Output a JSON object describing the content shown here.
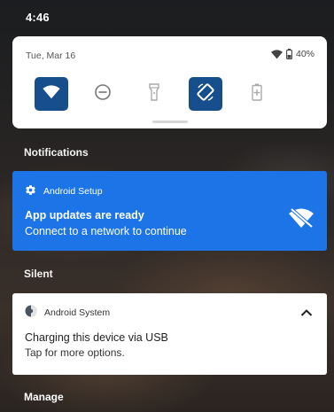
{
  "status_bar": {
    "time": "4:46"
  },
  "quick_settings": {
    "date": "Tue, Mar 16",
    "battery_percent": "40%",
    "tiles": [
      {
        "name": "wifi",
        "icon": "wifi-icon",
        "active": true
      },
      {
        "name": "do-not-disturb",
        "icon": "do-not-disturb-icon",
        "active": false
      },
      {
        "name": "flashlight",
        "icon": "flashlight-icon",
        "active": false
      },
      {
        "name": "auto-rotate",
        "icon": "auto-rotate-icon",
        "active": true
      },
      {
        "name": "battery-saver",
        "icon": "battery-saver-icon",
        "active": false
      }
    ]
  },
  "notifications": {
    "header": "Notifications",
    "setup": {
      "app_name": "Android Setup",
      "title": "App updates are ready",
      "text": "Connect to a network to continue",
      "app_icon": "gear-icon",
      "action_icon": "wifi-off-icon"
    }
  },
  "silent": {
    "header": "Silent",
    "system": {
      "app_name": "Android System",
      "title": "Charging this device via USB",
      "text": "Tap for more options.",
      "app_icon": "android-system-icon",
      "toggle_icon": "chevron-up-icon"
    }
  },
  "manage_label": "Manage",
  "colors": {
    "tile_active": "#174e8c",
    "setup_card": "#1d74e6",
    "panel": "#ffffff"
  }
}
